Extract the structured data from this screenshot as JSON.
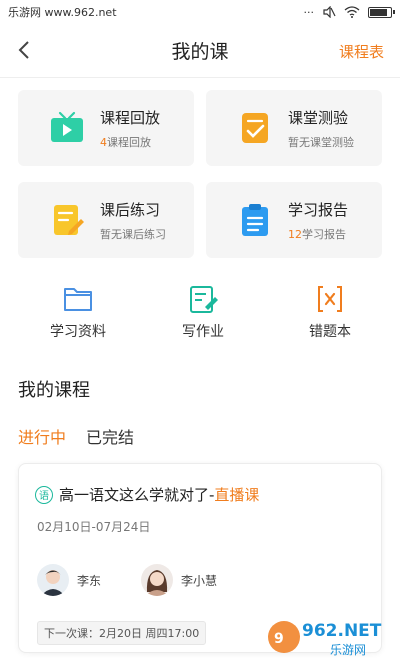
{
  "status_bar": {
    "left_text": "乐游网 www.962.net"
  },
  "nav": {
    "title": "我的课",
    "right_link": "课程表"
  },
  "cards": [
    {
      "title": "课程回放",
      "sub_num": "4",
      "sub_text": "课程回放",
      "icon": "tv-icon",
      "color": "#2ecfa6"
    },
    {
      "title": "课堂测验",
      "sub_num": "",
      "sub_text": "暂无课堂测验",
      "icon": "quiz-icon",
      "color": "#f5a623"
    },
    {
      "title": "课后练习",
      "sub_num": "",
      "sub_text": "暂无课后练习",
      "icon": "practice-icon",
      "color": "#f8c62b"
    },
    {
      "title": "学习报告",
      "sub_num": "12",
      "sub_text": "学习报告",
      "icon": "report-icon",
      "color": "#2d9bf0"
    }
  ],
  "shortcuts": [
    {
      "label": "学习资料",
      "icon": "folder-icon",
      "color": "#4a90e2"
    },
    {
      "label": "写作业",
      "icon": "homework-icon",
      "color": "#1bb89c"
    },
    {
      "label": "错题本",
      "icon": "mistake-book-icon",
      "color": "#f07d1e"
    }
  ],
  "section": {
    "title": "我的课程",
    "tabs": [
      "进行中",
      "已完结"
    ]
  },
  "course": {
    "subject_badge": "语",
    "title": "高一语文这么学就对了-",
    "tag": "直播课",
    "dates": "02月10日-07月24日",
    "teachers": [
      {
        "name": "李东",
        "avatar": "teacher-avatar"
      },
      {
        "name": "李小慧",
        "avatar": "teacher-avatar"
      }
    ],
    "next_lesson": "下一次课：2月20日 周四17:00"
  },
  "watermark": {
    "brand": "962.NET",
    "sub": "乐游网"
  },
  "colors": {
    "accent": "#f07d1e",
    "teal": "#1bb89c"
  }
}
